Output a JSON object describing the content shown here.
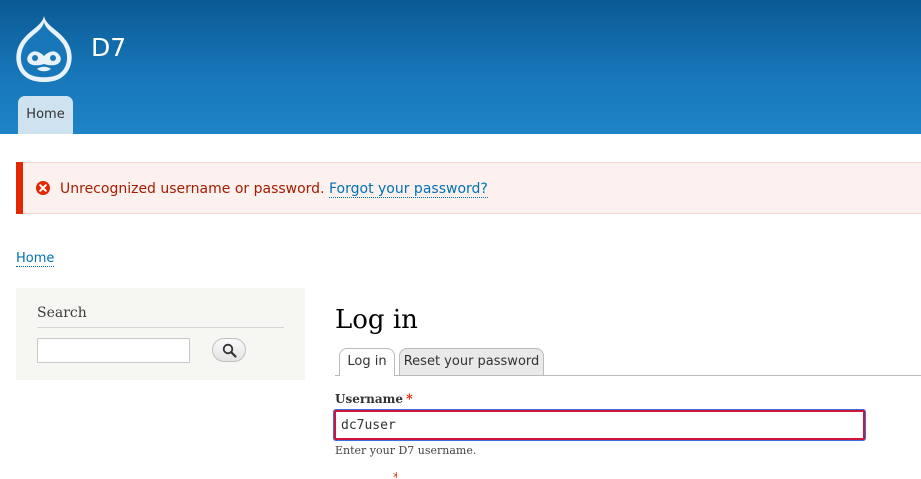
{
  "header": {
    "site_name": "D7",
    "nav_tab": "Home",
    "brand_color": "#0a5a94"
  },
  "messages": {
    "error_text": "Unrecognized username or password.",
    "link_text": "Forgot your password?",
    "error_color": "#a51b00",
    "icon": "error-icon"
  },
  "breadcrumb": {
    "home": "Home"
  },
  "sidebar": {
    "search_title": "Search",
    "search_value": "",
    "search_icon": "search-icon"
  },
  "main": {
    "title": "Log in",
    "tabs": [
      {
        "label": "Log in",
        "active": true
      },
      {
        "label": "Reset your password",
        "active": false
      }
    ],
    "username": {
      "label": "Username",
      "required_mark": "*",
      "value": "dc7user",
      "description": "Enter your D7 username."
    }
  }
}
